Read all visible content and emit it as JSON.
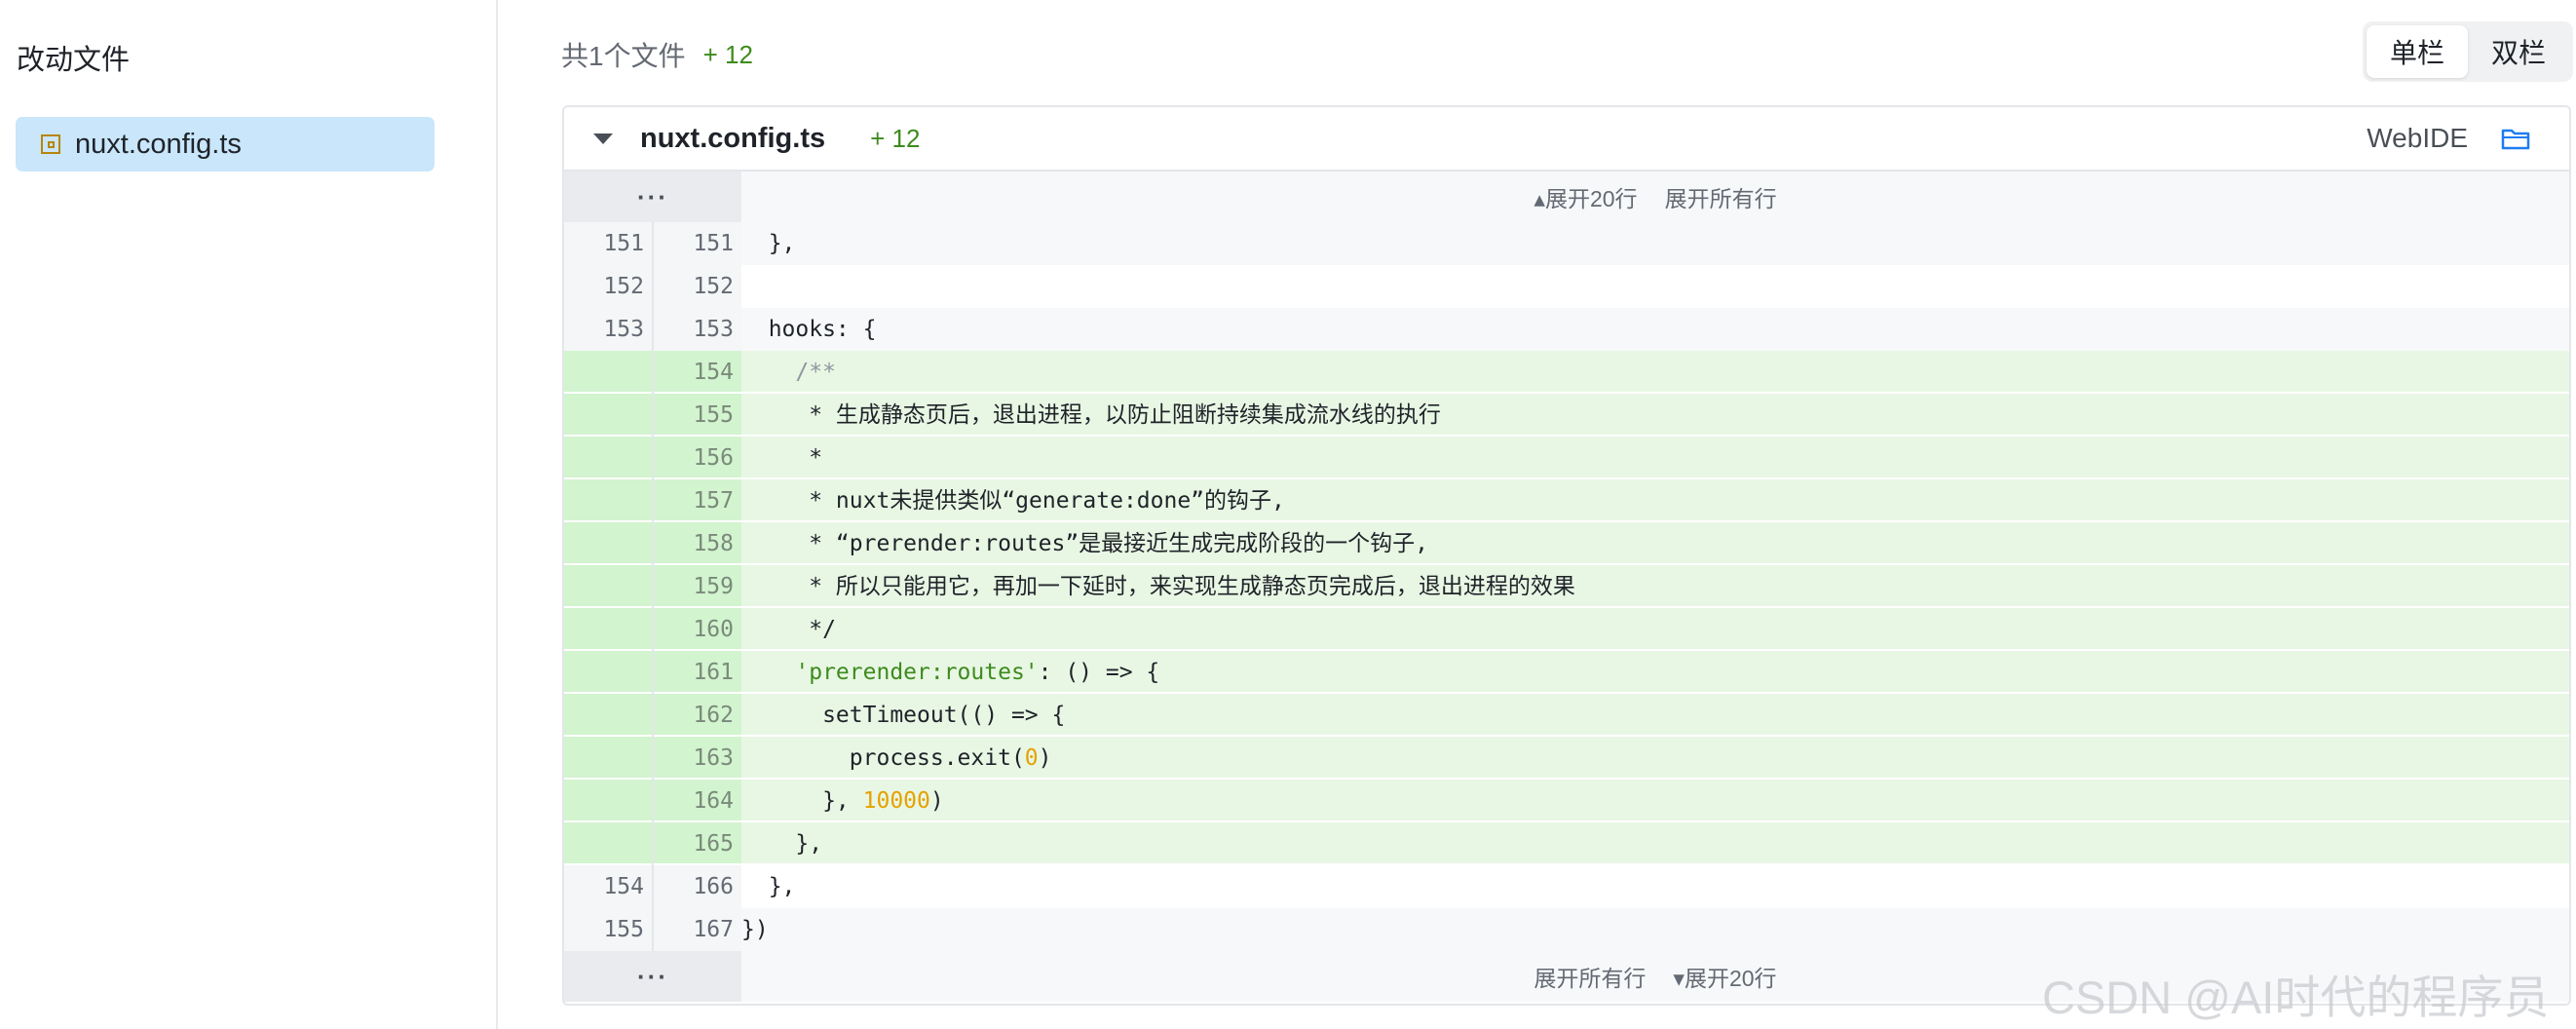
{
  "sidebar": {
    "title": "改动文件",
    "files": [
      {
        "name": "nuxt.config.ts",
        "icon": "file-modified-icon"
      }
    ]
  },
  "summary": {
    "count_text": "共1个文件",
    "additions": "+ 12"
  },
  "view_toggle": {
    "single": "单栏",
    "double": "双栏",
    "selected": "单栏"
  },
  "diff": {
    "file_name": "nuxt.config.ts",
    "additions": "+ 12",
    "webide_label": "WebIDE",
    "expand_top": {
      "dots": "···",
      "expand_20": "▴展开20行",
      "expand_all": "展开所有行"
    },
    "expand_bottom": {
      "dots": "···",
      "expand_all": "展开所有行",
      "expand_20": "▾展开20行"
    },
    "lines": [
      {
        "old": "151",
        "new": "151",
        "type": "ctx",
        "code": "  },"
      },
      {
        "old": "152",
        "new": "152",
        "type": "ctx",
        "code": ""
      },
      {
        "old": "153",
        "new": "153",
        "type": "ctx",
        "code": "  hooks: {"
      },
      {
        "old": "",
        "new": "154",
        "type": "add",
        "code": "    /**"
      },
      {
        "old": "",
        "new": "155",
        "type": "add",
        "code": "     * 生成静态页后，退出进程，以防止阻断持续集成流水线的执行"
      },
      {
        "old": "",
        "new": "156",
        "type": "add",
        "code": "     *"
      },
      {
        "old": "",
        "new": "157",
        "type": "add",
        "code": "     * nuxt未提供类似“generate:done”的钩子,"
      },
      {
        "old": "",
        "new": "158",
        "type": "add",
        "code": "     * “prerender:routes”是最接近生成完成阶段的一个钩子,"
      },
      {
        "old": "",
        "new": "159",
        "type": "add",
        "code": "     * 所以只能用它，再加一下延时，来实现生成静态页完成后，退出进程的效果"
      },
      {
        "old": "",
        "new": "160",
        "type": "add",
        "code": "     */"
      },
      {
        "old": "",
        "new": "161",
        "type": "add",
        "code_parts": [
          [
            "    ",
            ""
          ],
          [
            "'prerender:routes'",
            "str"
          ],
          [
            ": () => {",
            ""
          ]
        ]
      },
      {
        "old": "",
        "new": "162",
        "type": "add",
        "code": "      setTimeout(() => {"
      },
      {
        "old": "",
        "new": "163",
        "type": "add",
        "code_parts": [
          [
            "        process.exit(",
            ""
          ],
          [
            "0",
            "num"
          ],
          [
            ")",
            ""
          ]
        ]
      },
      {
        "old": "",
        "new": "164",
        "type": "add",
        "code_parts": [
          [
            "      }, ",
            ""
          ],
          [
            "10000",
            "num"
          ],
          [
            ")",
            ""
          ]
        ]
      },
      {
        "old": "",
        "new": "165",
        "type": "add",
        "code": "    },"
      },
      {
        "old": "154",
        "new": "166",
        "type": "ctx",
        "code": "  },"
      },
      {
        "old": "155",
        "new": "167",
        "type": "ctx",
        "code": "})"
      }
    ]
  },
  "watermark": "CSDN @AI时代的程序员"
}
